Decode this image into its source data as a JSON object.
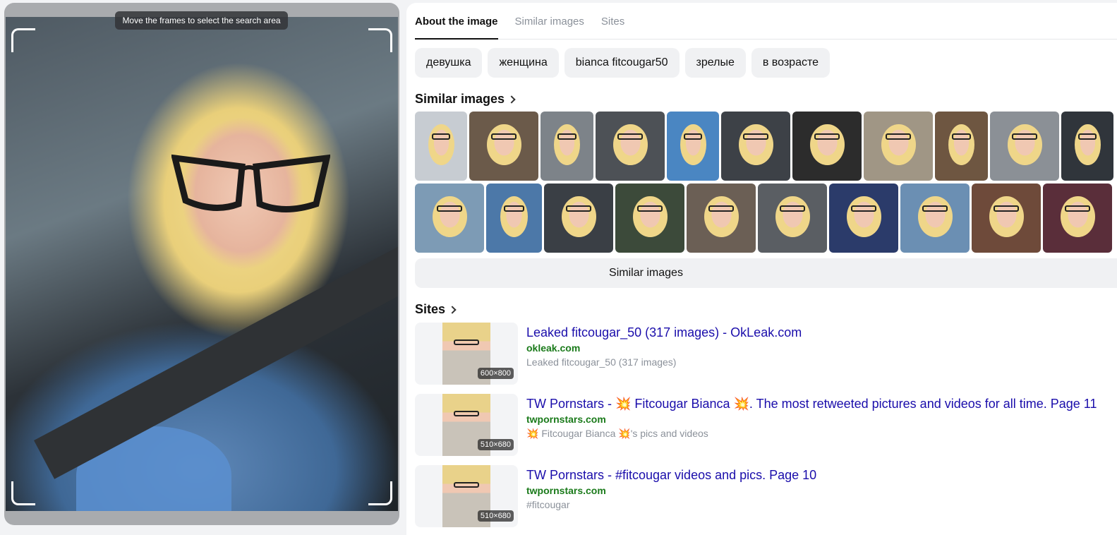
{
  "crop": {
    "tooltip": "Move the frames to select the search area"
  },
  "tabs": [
    {
      "label": "About the image",
      "active": true
    },
    {
      "label": "Similar images",
      "active": false
    },
    {
      "label": "Sites",
      "active": false
    }
  ],
  "tags": [
    "девушка",
    "женщина",
    "bianca fitcougar50",
    "зрелые",
    "в возрасте"
  ],
  "similar": {
    "title": "Similar images",
    "button_label": "Similar images"
  },
  "sites_section": {
    "title": "Sites",
    "items": [
      {
        "title": "Leaked fitcougar_50 (317 images) - OkLeak.com",
        "domain": "okleak.com",
        "description": "Leaked fitcougar_50 (317 images)",
        "dims": "600×800"
      },
      {
        "title": "TW Pornstars - 💥 Fitcougar Bianca 💥. The most retweeted pictures and videos for all time. Page 11",
        "domain": "twpornstars.com",
        "description": "💥 Fitcougar Bianca 💥's pics and videos",
        "dims": "510×680"
      },
      {
        "title": "TW Pornstars - #fitcougar videos and pics. Page 10",
        "domain": "twpornstars.com",
        "description": "#fitcougar",
        "dims": "510×680"
      }
    ]
  },
  "colors": {
    "link": "#1a0dab",
    "domain": "#1a7a1a",
    "muted": "#8b919a"
  }
}
